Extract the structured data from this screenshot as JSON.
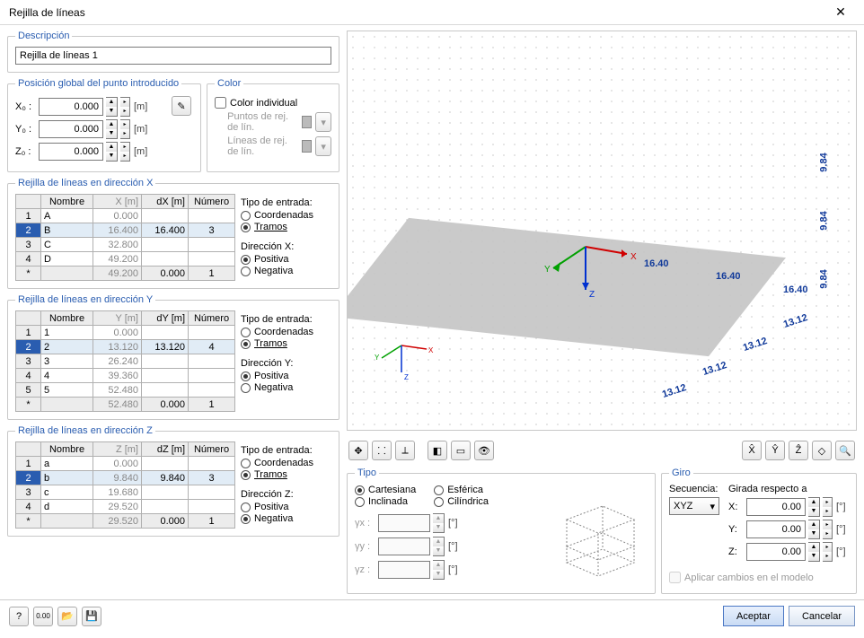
{
  "window": {
    "title": "Rejilla de líneas"
  },
  "descripcion": {
    "label": "Descripción",
    "value": "Rejilla de líneas 1"
  },
  "posicion": {
    "label": "Posición global del punto introducido",
    "x_label": "X₀ :",
    "y_label": "Y₀ :",
    "z_label": "Z₀ :",
    "x": "0.000",
    "y": "0.000",
    "z": "0.000",
    "unit": "[m]"
  },
  "color": {
    "label": "Color",
    "individual": "Color individual",
    "puntos": "Puntos de rej. de lín.",
    "lineas": "Líneas de rej. de lín."
  },
  "dirX": {
    "label": "Rejilla de líneas en dirección X",
    "headers": [
      "Nombre",
      "X [m]",
      "dX [m]",
      "Número"
    ],
    "rows": [
      {
        "n": "1",
        "name": "A",
        "v": "0.000",
        "d": "",
        "num": ""
      },
      {
        "n": "2",
        "name": "B",
        "v": "16.400",
        "d": "16.400",
        "num": "3",
        "sel": true
      },
      {
        "n": "3",
        "name": "C",
        "v": "32.800",
        "d": "",
        "num": ""
      },
      {
        "n": "4",
        "name": "D",
        "v": "49.200",
        "d": "",
        "num": ""
      },
      {
        "n": "*",
        "name": "",
        "v": "49.200",
        "d": "0.000",
        "num": "1",
        "star": true
      }
    ],
    "tipo_label": "Tipo de entrada:",
    "coord_label": "Coordenadas",
    "tramo_label": "Tramos",
    "dir_label": "Dirección X:",
    "pos_label": "Positiva",
    "neg_label": "Negativa",
    "coord_on": false,
    "tramo_on": true,
    "pos_on": true,
    "neg_on": false
  },
  "dirY": {
    "label": "Rejilla de líneas en dirección Y",
    "headers": [
      "Nombre",
      "Y [m]",
      "dY [m]",
      "Número"
    ],
    "rows": [
      {
        "n": "1",
        "name": "1",
        "v": "0.000",
        "d": "",
        "num": ""
      },
      {
        "n": "2",
        "name": "2",
        "v": "13.120",
        "d": "13.120",
        "num": "4",
        "sel": true
      },
      {
        "n": "3",
        "name": "3",
        "v": "26.240",
        "d": "",
        "num": ""
      },
      {
        "n": "4",
        "name": "4",
        "v": "39.360",
        "d": "",
        "num": ""
      },
      {
        "n": "5",
        "name": "5",
        "v": "52.480",
        "d": "",
        "num": ""
      },
      {
        "n": "*",
        "name": "",
        "v": "52.480",
        "d": "0.000",
        "num": "1",
        "star": true
      }
    ],
    "tipo_label": "Tipo de entrada:",
    "coord_label": "Coordenadas",
    "tramo_label": "Tramos",
    "dir_label": "Dirección Y:",
    "pos_label": "Positiva",
    "neg_label": "Negativa",
    "coord_on": false,
    "tramo_on": true,
    "pos_on": true,
    "neg_on": false
  },
  "dirZ": {
    "label": "Rejilla de líneas en dirección Z",
    "headers": [
      "Nombre",
      "Z [m]",
      "dZ [m]",
      "Número"
    ],
    "rows": [
      {
        "n": "1",
        "name": "a",
        "v": "0.000",
        "d": "",
        "num": ""
      },
      {
        "n": "2",
        "name": "b",
        "v": "9.840",
        "d": "9.840",
        "num": "3",
        "sel": true
      },
      {
        "n": "3",
        "name": "c",
        "v": "19.680",
        "d": "",
        "num": ""
      },
      {
        "n": "4",
        "name": "d",
        "v": "29.520",
        "d": "",
        "num": ""
      },
      {
        "n": "*",
        "name": "",
        "v": "29.520",
        "d": "0.000",
        "num": "1",
        "star": true
      }
    ],
    "tipo_label": "Tipo de entrada:",
    "coord_label": "Coordenadas",
    "tramo_label": "Tramos",
    "dir_label": "Dirección Z:",
    "pos_label": "Positiva",
    "neg_label": "Negativa",
    "coord_on": false,
    "tramo_on": true,
    "pos_on": false,
    "neg_on": true
  },
  "tipo": {
    "label": "Tipo",
    "cart": "Cartesiana",
    "incl": "Inclinada",
    "esf": "Esférica",
    "cil": "Cilíndrica",
    "gx": "γx :",
    "gy": "γy :",
    "gz": "γz :",
    "unit": "[°]",
    "cart_on": true
  },
  "giro": {
    "label": "Giro",
    "sec_label": "Secuencia:",
    "resp_label": "Girada respecto a",
    "sec": "XYZ",
    "rows": [
      {
        "lbl": "X:",
        "v": "0.00"
      },
      {
        "lbl": "Y:",
        "v": "0.00"
      },
      {
        "lbl": "Z:",
        "v": "0.00"
      }
    ],
    "unit": "[°]",
    "apply": "Aplicar cambios en el modelo"
  },
  "viewport_dims": {
    "d1": "16.40",
    "d2": "16.40",
    "d3": "16.40",
    "e1": "13.12",
    "e2": "13.12",
    "e3": "13.12",
    "e4": "13.12",
    "h1": "9.84",
    "h2": "9.84",
    "h3": "9.84"
  },
  "footer": {
    "accept": "Aceptar",
    "cancel": "Cancelar"
  }
}
